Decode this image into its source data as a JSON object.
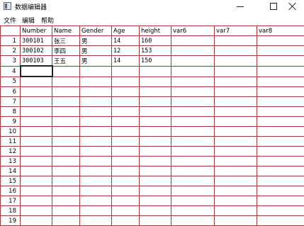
{
  "window": {
    "title": "数据编辑器"
  },
  "menu": [
    "文件",
    "编辑",
    "帮助"
  ],
  "grid": {
    "columns": [
      "Number",
      "Name",
      "Gender",
      "Age",
      "height",
      "var6",
      "var7",
      "var8"
    ],
    "row_numbers": [
      "1",
      "2",
      "3",
      "4",
      "5",
      "6",
      "7",
      "8",
      "9",
      "10",
      "11",
      "12",
      "13",
      "14",
      "15",
      "16",
      "17",
      "18",
      "19"
    ],
    "rows": [
      [
        "300101",
        "张三",
        "男",
        "14",
        "160",
        "",
        "",
        ""
      ],
      [
        "300102",
        "李四",
        "男",
        "12",
        "153",
        "",
        "",
        ""
      ],
      [
        "300103",
        "王五",
        "男",
        "14",
        "150",
        "",
        "",
        ""
      ]
    ],
    "selected_cell": "row 4, Number"
  }
}
